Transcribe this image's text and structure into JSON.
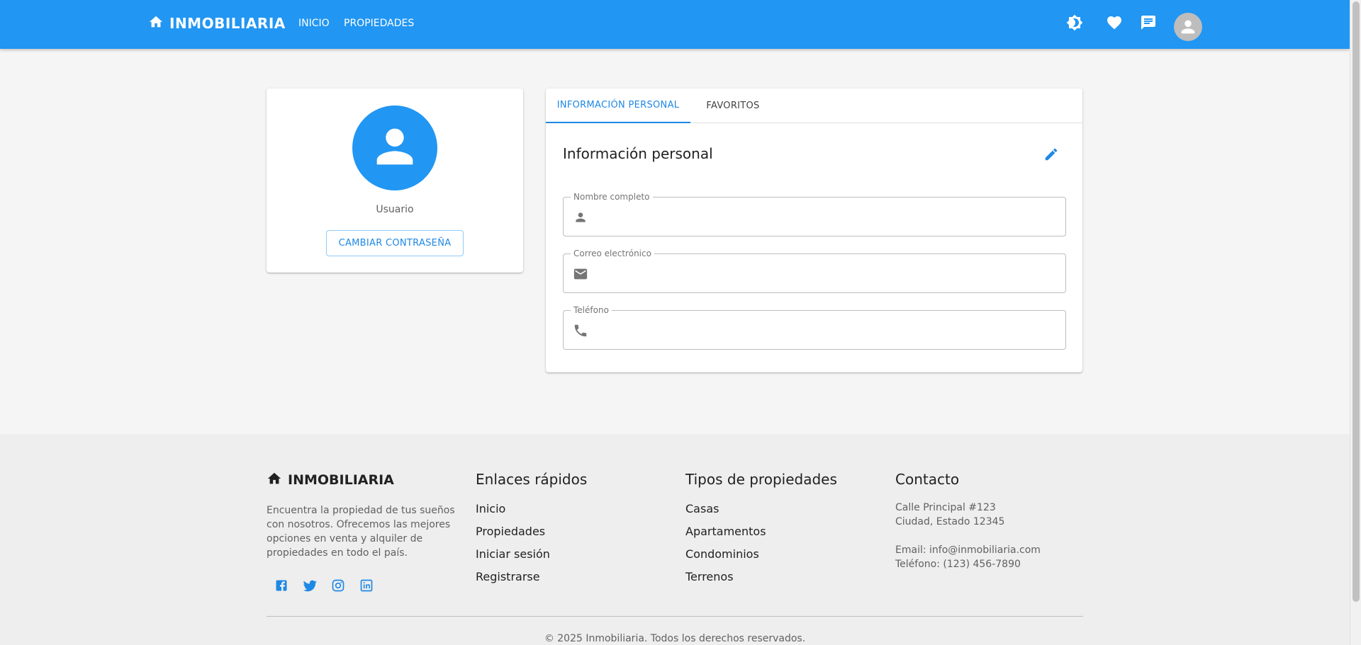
{
  "colors": {
    "primary": "#2196f3",
    "accent_text": "#1e88e5",
    "footer_bg": "#eeeeee",
    "page_bg": "#f5f5f5"
  },
  "header": {
    "brand_icon": "home-icon",
    "brand": "INMOBILIARIA",
    "nav": [
      "INICIO",
      "PROPIEDADES"
    ],
    "icons": [
      "theme-toggle-icon",
      "favorites-heart-icon",
      "messages-icon",
      "user-avatar-icon"
    ]
  },
  "profile": {
    "avatar_icon": "person-icon",
    "name": "Usuario",
    "change_password": "CAMBIAR CONTRASEÑA"
  },
  "tabs": [
    {
      "label": "INFORMACIÓN PERSONAL",
      "active": true
    },
    {
      "label": "FAVORITOS",
      "active": false
    }
  ],
  "info": {
    "title": "Información personal",
    "edit_icon": "pencil-icon",
    "fields": [
      {
        "label": "Nombre completo",
        "icon": "person-icon",
        "value": ""
      },
      {
        "label": "Correo electrónico",
        "icon": "mail-icon",
        "value": ""
      },
      {
        "label": "Teléfono",
        "icon": "phone-icon",
        "value": ""
      }
    ]
  },
  "footer": {
    "brand": "INMOBILIARIA",
    "description": "Encuentra la propiedad de tus sueños con nosotros. Ofrecemos las mejores opciones en venta y alquiler de propiedades en todo el país.",
    "social_icons": [
      "facebook-icon",
      "twitter-icon",
      "instagram-icon",
      "linkedin-icon"
    ],
    "quick_links_title": "Enlaces rápidos",
    "quick_links": [
      "Inicio",
      "Propiedades",
      "Iniciar sesión",
      "Registrarse"
    ],
    "types_title": "Tipos de propiedades",
    "types": [
      "Casas",
      "Apartamentos",
      "Condominios",
      "Terrenos"
    ],
    "contact_title": "Contacto",
    "address_line1": "Calle Principal #123",
    "address_line2": "Ciudad, Estado 12345",
    "email": "Email: info@inmobiliaria.com",
    "phone": "Teléfono: (123) 456-7890",
    "copyright": "© 2025 Inmobiliaria. Todos los derechos reservados."
  }
}
